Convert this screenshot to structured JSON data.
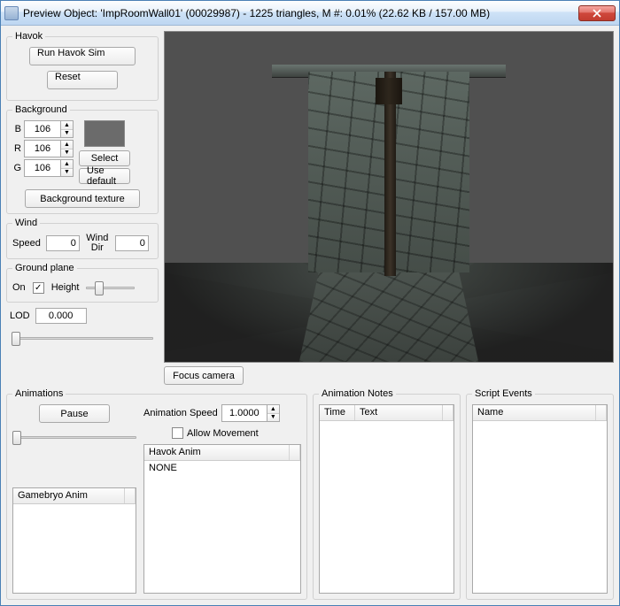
{
  "window": {
    "title": "Preview Object: 'ImpRoomWall01' (00029987) - 1225 triangles, M #: 0.01% (22.62 KB / 157.00 MB)"
  },
  "havok": {
    "legend": "Havok",
    "run_label": "Run Havok Sim",
    "reset_label": "Reset"
  },
  "background": {
    "legend": "Background",
    "b_label": "B",
    "b_value": "106",
    "r_label": "R",
    "r_value": "106",
    "g_label": "G",
    "g_value": "106",
    "select_label": "Select",
    "use_default_label": "Use default",
    "texture_label": "Background texture"
  },
  "wind": {
    "legend": "Wind",
    "speed_label": "Speed",
    "speed_value": "0",
    "dir_label": "Wind Dir",
    "dir_value": "0"
  },
  "ground": {
    "legend": "Ground plane",
    "on_label": "On",
    "on_checked": true,
    "height_label": "Height"
  },
  "lod": {
    "label": "LOD",
    "value": "0.000"
  },
  "viewport": {
    "focus_label": "Focus camera"
  },
  "animations": {
    "legend": "Animations",
    "pause_label": "Pause",
    "speed_label": "Animation Speed",
    "speed_value": "1.0000",
    "allow_move_label": "Allow Movement",
    "gamebryo_header": "Gamebryo Anim",
    "havok_header": "Havok Anim",
    "havok_rows": [
      "NONE"
    ]
  },
  "notes": {
    "legend": "Animation Notes",
    "col_time": "Time",
    "col_text": "Text"
  },
  "events": {
    "legend": "Script Events",
    "col_name": "Name"
  }
}
